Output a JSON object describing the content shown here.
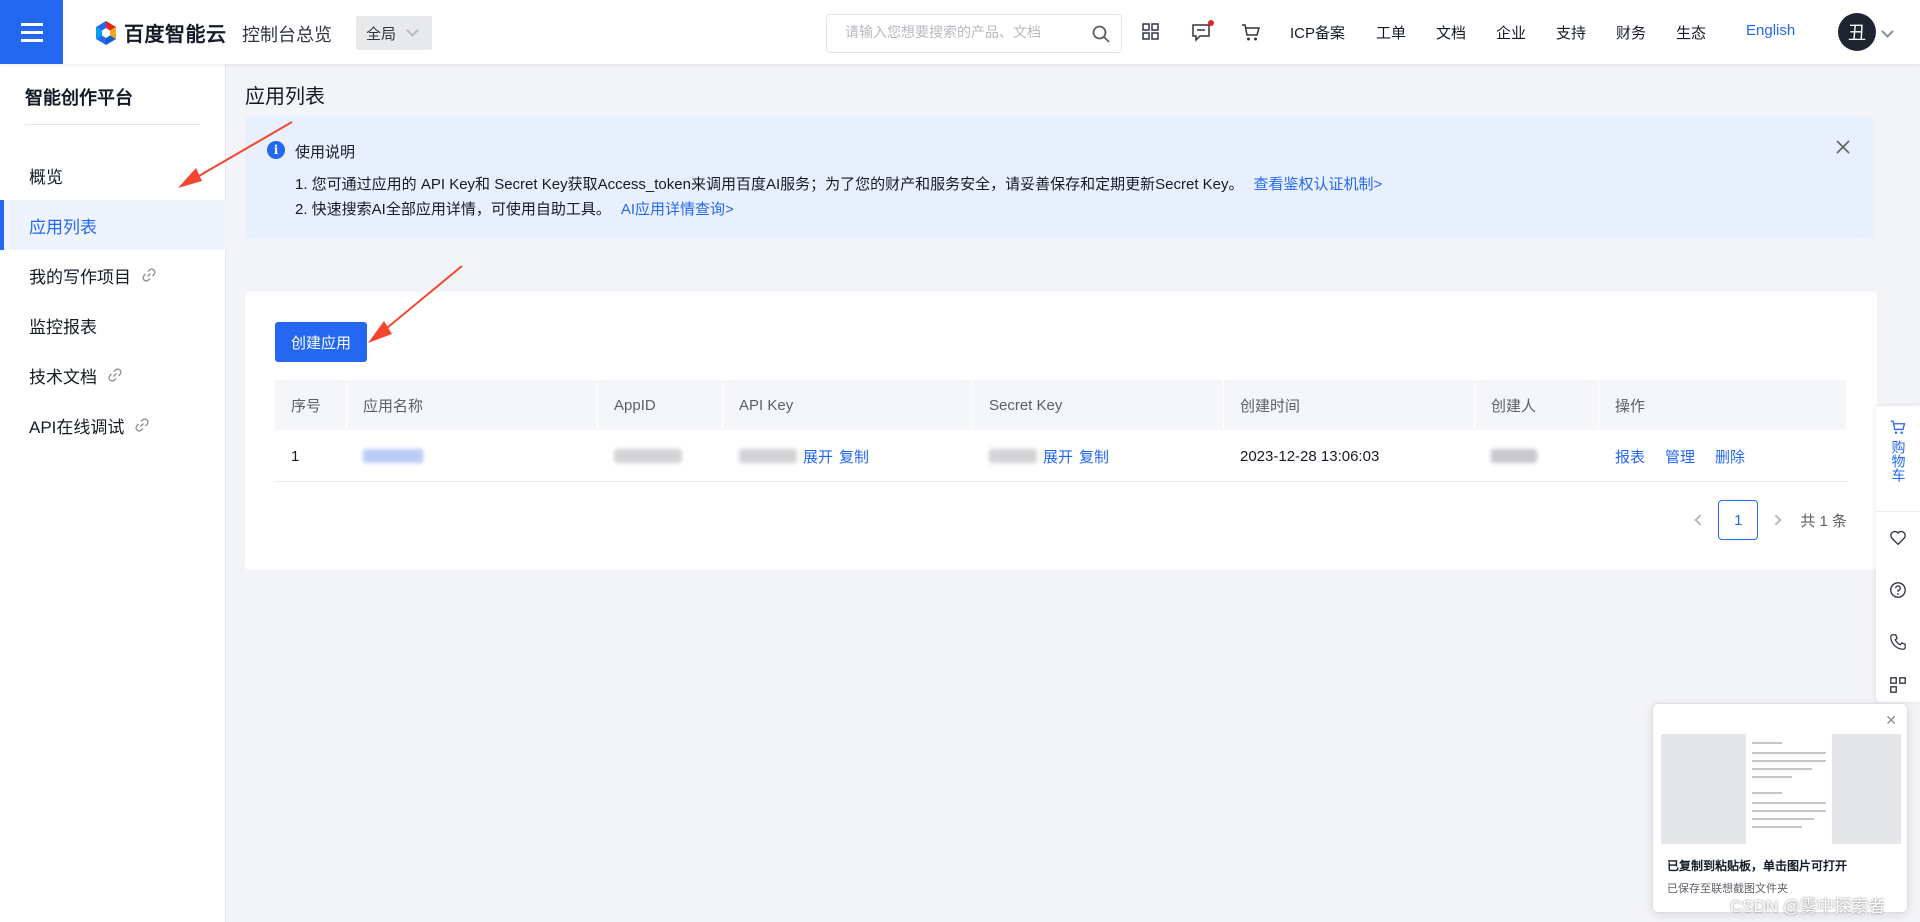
{
  "header": {
    "brand": "百度智能云",
    "console_title": "控制台总览",
    "region": "全局",
    "search_placeholder": "请输入您想要搜索的产品、文档",
    "nav_links": [
      "ICP备案",
      "工单",
      "文档",
      "企业",
      "支持",
      "财务",
      "生态"
    ],
    "language": "English",
    "avatar_text": "丑"
  },
  "sidebar": {
    "title": "智能创作平台",
    "items": [
      {
        "label": "概览",
        "active": false,
        "external": false
      },
      {
        "label": "应用列表",
        "active": true,
        "external": false
      },
      {
        "label": "我的写作项目",
        "active": false,
        "external": true
      },
      {
        "label": "监控报表",
        "active": false,
        "external": false
      },
      {
        "label": "技术文档",
        "active": false,
        "external": true
      },
      {
        "label": "API在线调试",
        "active": false,
        "external": true
      }
    ]
  },
  "main": {
    "page_title": "应用列表",
    "notice": {
      "title": "使用说明",
      "line1": "1. 您可通过应用的 API Key和 Secret Key获取Access_token来调用百度AI服务；为了您的财产和服务安全，请妥善保存和定期更新Secret Key。",
      "line1_link": "查看鉴权认证机制>",
      "line2": "2. 快速搜索AI全部应用详情，可使用自助工具。",
      "line2_link": "AI应用详情查询>"
    },
    "create_button": "创建应用",
    "table": {
      "headers": [
        "序号",
        "应用名称",
        "AppID",
        "API Key",
        "Secret Key",
        "创建时间",
        "创建人",
        "操作"
      ],
      "rows": [
        {
          "index": "1",
          "api_key_actions": [
            "展开",
            "复制"
          ],
          "secret_key_actions": [
            "展开",
            "复制"
          ],
          "created_at": "2023-12-28 13:06:03",
          "operations": [
            "报表",
            "管理",
            "删除"
          ]
        }
      ]
    },
    "pagination": {
      "current": "1",
      "total_text": "共 1 条"
    }
  },
  "float_bar": {
    "cart_label": "购物车"
  },
  "toast": {
    "title": "已复制到粘贴板，单击图片可打开",
    "subtitle": "已保存至联想截图文件夹"
  },
  "watermark": "CSDN @雾中探索者",
  "colors": {
    "primary": "#2468f2",
    "annotation_arrow": "#f2462e"
  }
}
